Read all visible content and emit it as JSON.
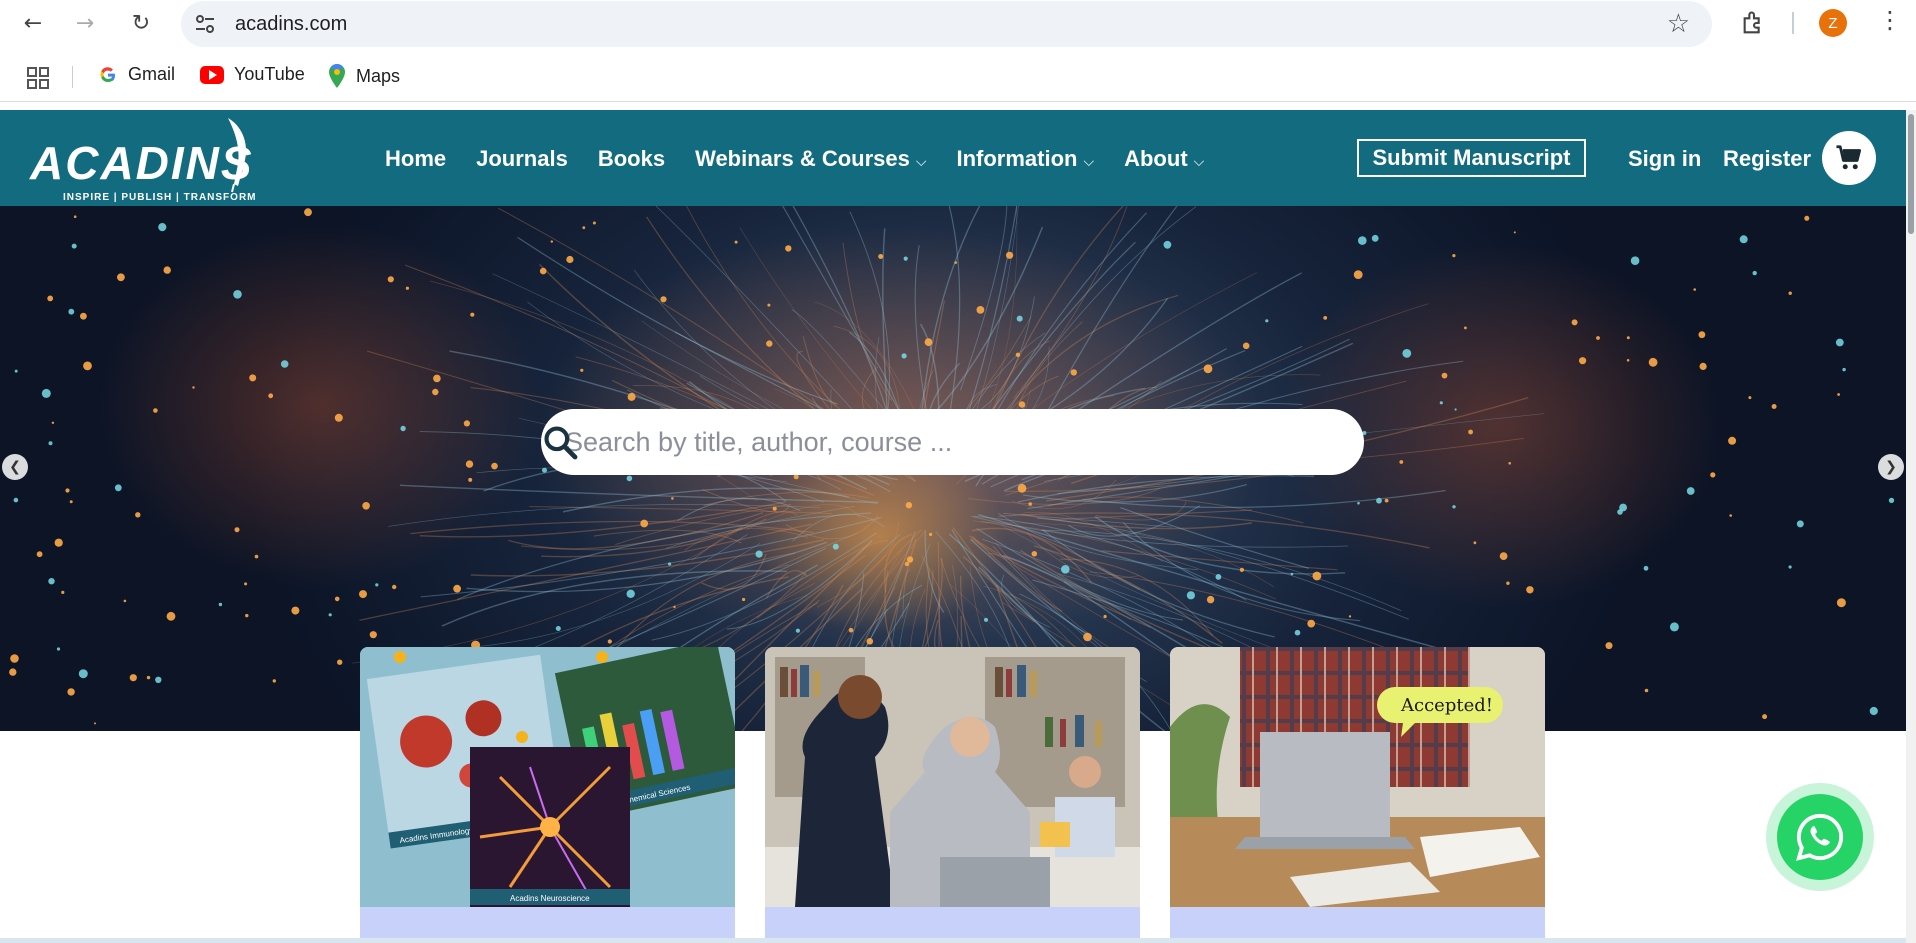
{
  "browser": {
    "url": "acadins.com",
    "avatar_letter": "Z",
    "bookmarks": [
      {
        "label": "Gmail",
        "icon": "google-icon"
      },
      {
        "label": "YouTube",
        "icon": "youtube-icon"
      },
      {
        "label": "Maps",
        "icon": "maps-icon"
      }
    ]
  },
  "header": {
    "logo_text": "ACADINS",
    "logo_tagline": "INSPIRE | PUBLISH | TRANSFORM",
    "nav": [
      {
        "label": "Home",
        "dropdown": false
      },
      {
        "label": "Journals",
        "dropdown": false
      },
      {
        "label": "Books",
        "dropdown": false
      },
      {
        "label": "Webinars & Courses",
        "dropdown": true
      },
      {
        "label": "Information",
        "dropdown": true
      },
      {
        "label": "About",
        "dropdown": true
      }
    ],
    "submit_label": "Submit Manuscript",
    "signin_label": "Sign in",
    "register_label": "Register",
    "bg_color": "#136b80"
  },
  "hero": {
    "search_placeholder": "Search by title, author, course ..."
  },
  "cards": [
    {
      "image": "journal-covers-image",
      "badge": ""
    },
    {
      "image": "library-people-image",
      "badge": ""
    },
    {
      "image": "accepted-laptop-image",
      "badge": "Accepted!"
    }
  ],
  "cover_labels": {
    "immunology": "Acadins Immunology & Microbiology",
    "chemical": "Acadins Chemical Sciences",
    "neuro": "Acadins Neuroscience"
  }
}
